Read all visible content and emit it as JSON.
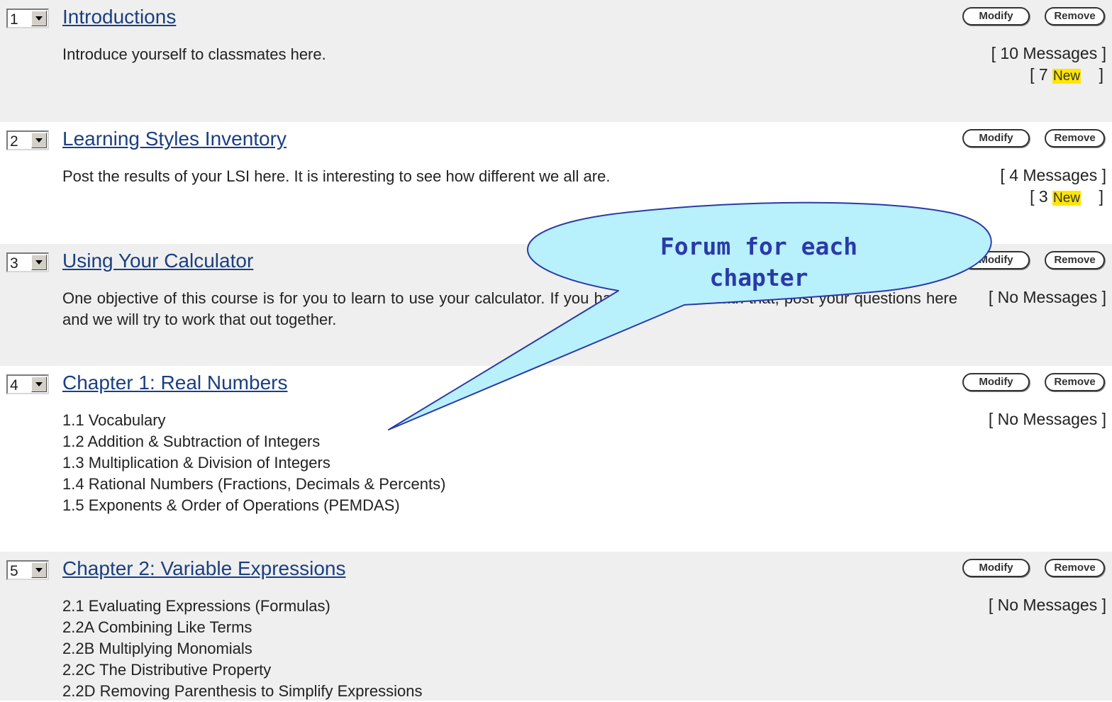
{
  "forums": [
    {
      "order": "1",
      "title": "Introductions",
      "description": [
        "Introduce yourself to classmates here."
      ],
      "messages": "[ 10 Messages ]",
      "new_prefix": "[ 7 ",
      "new_label": "New",
      "new_suffix": "    ]",
      "modify_label": "Modify",
      "remove_label": "Remove"
    },
    {
      "order": "2",
      "title": "Learning Styles Inventory",
      "description": [
        "Post the results of your LSI here. It is interesting to see how different we all are."
      ],
      "messages": "[ 4 Messages ]",
      "new_prefix": "[ 3 ",
      "new_label": "New",
      "new_suffix": "    ]",
      "modify_label": "Modify",
      "remove_label": "Remove"
    },
    {
      "order": "3",
      "title": "Using Your Calculator",
      "description": [
        "One objective of this course is for you to learn to use your calculator. If you have any trouble with that, post your questions here and we will try to work that out together."
      ],
      "messages": "[ No Messages ]",
      "modify_label": "Modify",
      "remove_label": "Remove"
    },
    {
      "order": "4",
      "title": "Chapter 1: Real Numbers",
      "description": [
        "1.1 Vocabulary",
        "1.2 Addition & Subtraction of Integers",
        "1.3 Multiplication & Division of Integers",
        "1.4 Rational Numbers (Fractions, Decimals & Percents)",
        "1.5 Exponents & Order of Operations (PEMDAS)"
      ],
      "messages": "[ No Messages ]",
      "modify_label": "Modify",
      "remove_label": "Remove"
    },
    {
      "order": "5",
      "title": "Chapter 2: Variable Expressions",
      "description": [
        "2.1 Evaluating Expressions (Formulas)",
        "2.2A Combining Like Terms",
        "2.2B Multiplying Monomials",
        "2.2C The Distributive Property",
        "2.2D Removing Parenthesis to Simplify Expressions"
      ],
      "messages": "[ No Messages ]",
      "modify_label": "Modify",
      "remove_label": "Remove"
    }
  ],
  "callout": {
    "line1": "Forum for each",
    "line2": "chapter"
  },
  "colors": {
    "title_link": "#1b3f80",
    "shaded_row": "#efefef",
    "new_badge": "#ffe600",
    "callout_fill": "#b8f0fc",
    "callout_text": "#2a3aa8"
  }
}
